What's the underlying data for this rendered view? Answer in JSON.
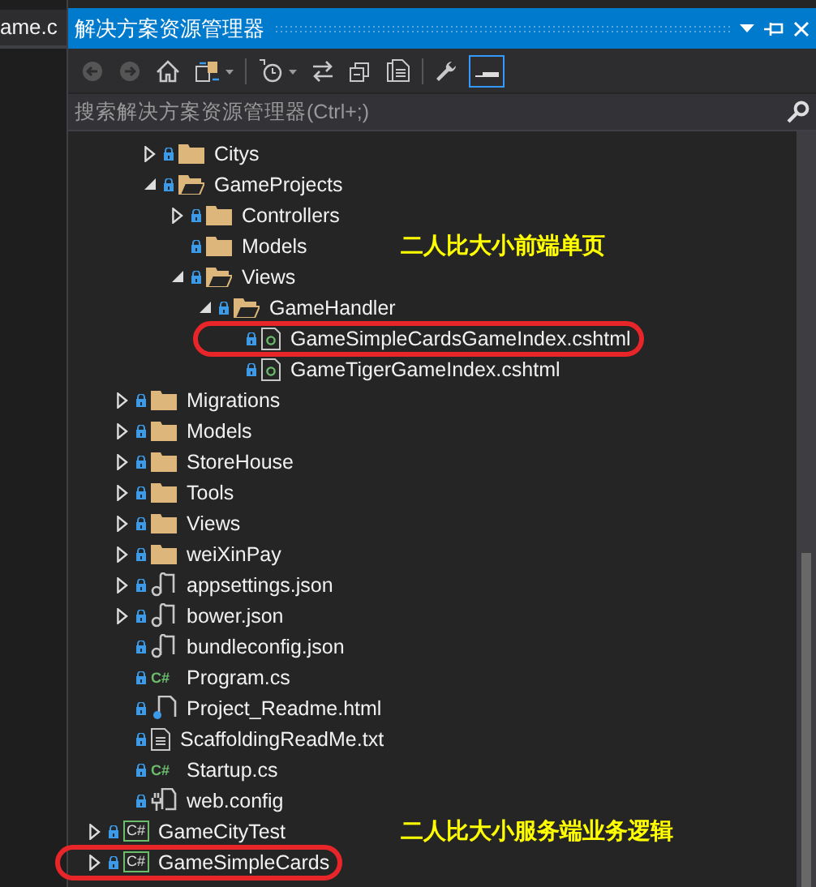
{
  "editor_tab": {
    "label": "ame.c"
  },
  "window": {
    "title": "解决方案资源管理器"
  },
  "search": {
    "placeholder": "搜索解决方案资源管理器(Ctrl+;)"
  },
  "tree": {
    "children": [
      {
        "children": [
          {
            "children": [
              {
                "label": "Citys",
                "kind": "folder",
                "expanded": false
              },
              {
                "label": "GameProjects",
                "kind": "folder-open",
                "expanded": true,
                "children": [
                  {
                    "label": "Controllers",
                    "kind": "folder",
                    "expanded": false
                  },
                  {
                    "label": "Models",
                    "kind": "folder",
                    "note": "二人比大小前端单页"
                  },
                  {
                    "label": "Views",
                    "kind": "folder-open",
                    "expanded": true,
                    "children": [
                      {
                        "label": "GameHandler",
                        "kind": "folder-open",
                        "expanded": true,
                        "children": [
                          {
                            "label": "GameSimpleCardsGameIndex.cshtml",
                            "kind": "cshtml",
                            "circled": true
                          },
                          {
                            "label": "GameTigerGameIndex.cshtml",
                            "kind": "cshtml"
                          }
                        ]
                      }
                    ]
                  }
                ]
              }
            ]
          },
          {
            "label": "Migrations",
            "kind": "folder",
            "expanded": false
          },
          {
            "label": "Models",
            "kind": "folder",
            "expanded": false
          },
          {
            "label": "StoreHouse",
            "kind": "folder",
            "expanded": false
          },
          {
            "label": "Tools",
            "kind": "folder",
            "expanded": false
          },
          {
            "label": "Views",
            "kind": "folder",
            "expanded": false
          },
          {
            "label": "weiXinPay",
            "kind": "folder",
            "expanded": false
          },
          {
            "label": "appsettings.json",
            "kind": "json",
            "expanded": false
          },
          {
            "label": "bower.json",
            "kind": "json",
            "expanded": false
          },
          {
            "label": "bundleconfig.json",
            "kind": "json"
          },
          {
            "label": "Program.cs",
            "kind": "cs",
            "badge": "C#"
          },
          {
            "label": "Project_Readme.html",
            "kind": "html"
          },
          {
            "label": "ScaffoldingReadMe.txt",
            "kind": "txt"
          },
          {
            "label": "Startup.cs",
            "kind": "cs",
            "badge": "C#"
          },
          {
            "label": "web.config",
            "kind": "config"
          }
        ]
      },
      {
        "label": "GameCityTest",
        "kind": "csproj",
        "badge": "C#",
        "expanded": false,
        "note": "二人比大小服务端业务逻辑"
      },
      {
        "label": "GameSimpleCards",
        "kind": "csproj",
        "badge": "C#",
        "expanded": false,
        "circled": true
      }
    ]
  }
}
